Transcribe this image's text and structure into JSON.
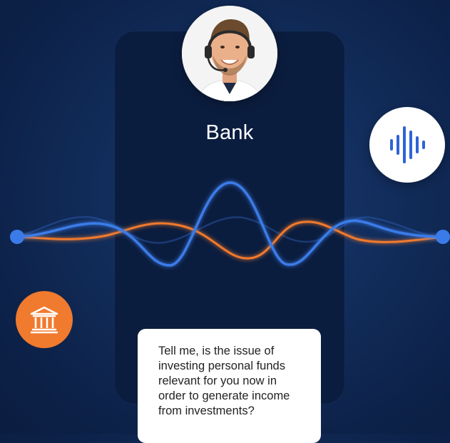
{
  "caller": {
    "name": "Bank",
    "avatar_description": "operator-with-headset"
  },
  "buttons": {
    "voice_icon": "voice-waveform-icon",
    "bank_icon": "bank-building-icon"
  },
  "message": {
    "text": "Tell me, is the issue of investing personal funds relevant for you now in order to generate income from investments?"
  },
  "colors": {
    "background": "#0d2249",
    "card": "#0b1d3f",
    "wave_blue": "#3b7be8",
    "wave_orange": "#f07a2e",
    "accent_orange": "#f07a2e",
    "icon_blue": "#2f63d6"
  }
}
